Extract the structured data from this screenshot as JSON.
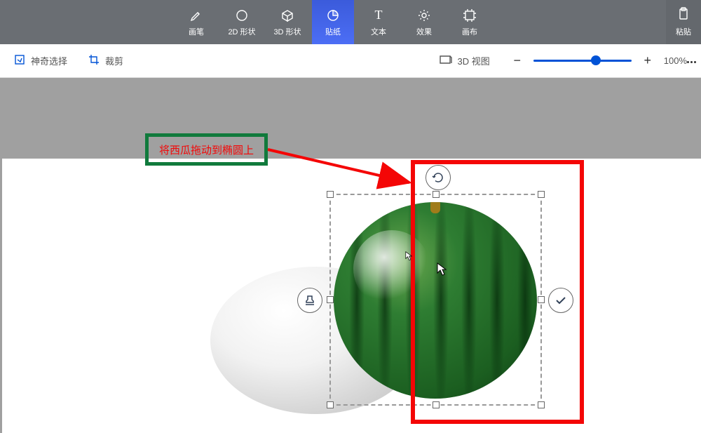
{
  "toolbar": {
    "brush": "画笔",
    "shape2d": "2D 形状",
    "shape3d": "3D 形状",
    "sticker": "贴纸",
    "text": "文本",
    "effects": "效果",
    "canvas": "画布",
    "paste": "粘贴"
  },
  "secondbar": {
    "magic_select": "神奇选择",
    "crop": "裁剪",
    "view3d": "3D 视图",
    "zoom_pct": "100%"
  },
  "annotation": {
    "instruction": "将西瓜拖动到椭圆上"
  },
  "colors": {
    "red": "#f40606",
    "green": "#107a3c",
    "accent": "#0052d6"
  }
}
